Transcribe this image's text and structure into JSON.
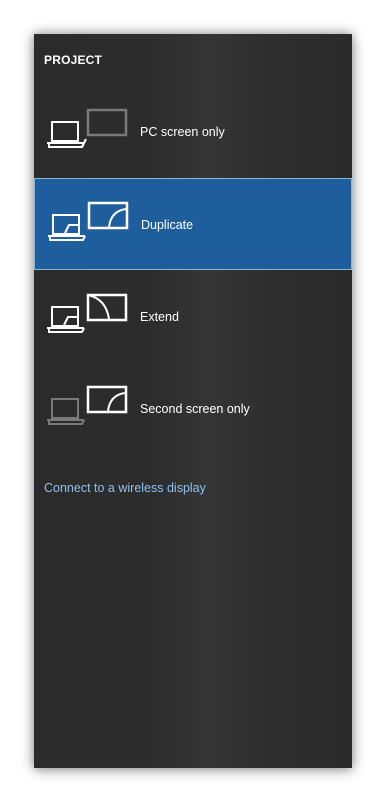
{
  "pane": {
    "title": "PROJECT"
  },
  "options": [
    {
      "label": "PC screen only",
      "icon": "pc-screen-only-icon",
      "selected": false
    },
    {
      "label": "Duplicate",
      "icon": "duplicate-icon",
      "selected": true
    },
    {
      "label": "Extend",
      "icon": "extend-icon",
      "selected": false
    },
    {
      "label": "Second screen only",
      "icon": "second-screen-only-icon",
      "selected": false
    }
  ],
  "wireless": {
    "link_text": "Connect to a wireless display"
  },
  "colors": {
    "pane_background": "#2c2c2c",
    "selected_background": "#1e5e9c",
    "selected_border": "#8bb4d8",
    "link": "#8ec0ee",
    "text": "#ffffff",
    "dimmed_icon": "#7a7a7a"
  }
}
